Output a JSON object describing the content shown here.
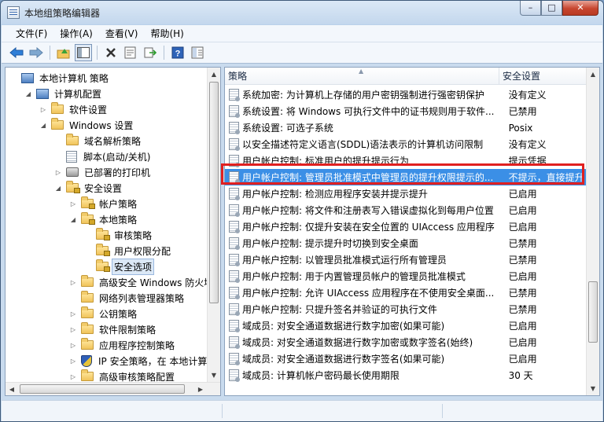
{
  "window": {
    "title": "本地组策略编辑器"
  },
  "window_buttons": {
    "minimize": "–",
    "maximize": "□",
    "close": "✕"
  },
  "menubar": {
    "items": [
      "文件(F)",
      "操作(A)",
      "查看(V)",
      "帮助(H)"
    ]
  },
  "toolbar": {
    "icons": [
      "back-arrow-icon",
      "forward-arrow-icon",
      "up-folder-icon",
      "show-hide-tree-icon",
      "delete-icon",
      "properties-icon",
      "export-list-icon",
      "help-icon",
      "extended-view-icon"
    ]
  },
  "tree": {
    "items": [
      {
        "label": "本地计算机 策略",
        "level": 0,
        "icon": "pc-icon",
        "twisty": ""
      },
      {
        "label": "计算机配置",
        "level": 1,
        "icon": "pc-icon",
        "twisty": "◢"
      },
      {
        "label": "软件设置",
        "level": 2,
        "icon": "folder-icon",
        "twisty": "▷"
      },
      {
        "label": "Windows 设置",
        "level": 2,
        "icon": "folder-icon",
        "twisty": "◢"
      },
      {
        "label": "域名解析策略",
        "level": 3,
        "icon": "folder-icon",
        "twisty": ""
      },
      {
        "label": "脚本(启动/关机)",
        "level": 3,
        "icon": "script-icon",
        "twisty": ""
      },
      {
        "label": "已部署的打印机",
        "level": 3,
        "icon": "printer-icon",
        "twisty": "▷"
      },
      {
        "label": "安全设置",
        "level": 3,
        "icon": "lock-folder-icon",
        "twisty": "◢"
      },
      {
        "label": "帐户策略",
        "level": 4,
        "icon": "lock-folder-icon",
        "twisty": "▷"
      },
      {
        "label": "本地策略",
        "level": 4,
        "icon": "lock-folder-icon",
        "twisty": "◢"
      },
      {
        "label": "审核策略",
        "level": 5,
        "icon": "lock-folder-icon",
        "twisty": ""
      },
      {
        "label": "用户权限分配",
        "level": 5,
        "icon": "lock-folder-icon",
        "twisty": ""
      },
      {
        "label": "安全选项",
        "level": 5,
        "icon": "lock-folder-icon",
        "twisty": "",
        "selected": true
      },
      {
        "label": "高级安全 Windows 防火墙",
        "level": 4,
        "icon": "folder-icon",
        "twisty": "▷"
      },
      {
        "label": "网络列表管理器策略",
        "level": 4,
        "icon": "folder-icon",
        "twisty": ""
      },
      {
        "label": "公钥策略",
        "level": 4,
        "icon": "folder-icon",
        "twisty": "▷"
      },
      {
        "label": "软件限制策略",
        "level": 4,
        "icon": "folder-icon",
        "twisty": "▷"
      },
      {
        "label": "应用程序控制策略",
        "level": 4,
        "icon": "folder-icon",
        "twisty": "▷"
      },
      {
        "label": "IP 安全策略，在 本地计算机",
        "level": 4,
        "icon": "shield-icon",
        "twisty": "▷"
      },
      {
        "label": "高级审核策略配置",
        "level": 4,
        "icon": "folder-icon",
        "twisty": "▷"
      }
    ]
  },
  "list": {
    "headers": {
      "policy": "策略",
      "setting": "安全设置"
    },
    "rows": [
      {
        "policy": "系统加密: 为计算机上存储的用户密钥强制进行强密钥保护",
        "setting": "没有定义"
      },
      {
        "policy": "系统设置: 将 Windows 可执行文件中的证书规则用于软件...",
        "setting": "已禁用"
      },
      {
        "policy": "系统设置: 可选子系统",
        "setting": "Posix"
      },
      {
        "policy": "以安全描述符定义语言(SDDL)语法表示的计算机访问限制",
        "setting": "没有定义"
      },
      {
        "policy": "用户帐户控制: 标准用户的提升提示行为",
        "setting": "提示凭据"
      },
      {
        "policy": "用户帐户控制: 管理员批准模式中管理员的提升权限提示的...",
        "setting": "不提示，直接提升",
        "selected": true
      },
      {
        "policy": "用户帐户控制: 检测应用程序安装并提示提升",
        "setting": "已启用"
      },
      {
        "policy": "用户帐户控制: 将文件和注册表写入错误虚拟化到每用户位置",
        "setting": "已启用"
      },
      {
        "policy": "用户帐户控制: 仅提升安装在安全位置的 UIAccess 应用程序",
        "setting": "已启用"
      },
      {
        "policy": "用户帐户控制: 提示提升时切换到安全桌面",
        "setting": "已禁用"
      },
      {
        "policy": "用户帐户控制: 以管理员批准模式运行所有管理员",
        "setting": "已禁用"
      },
      {
        "policy": "用户帐户控制: 用于内置管理员帐户的管理员批准模式",
        "setting": "已启用"
      },
      {
        "policy": "用户帐户控制: 允许 UIAccess 应用程序在不使用安全桌面...",
        "setting": "已禁用"
      },
      {
        "policy": "用户帐户控制: 只提升签名并验证的可执行文件",
        "setting": "已禁用"
      },
      {
        "policy": "域成员: 对安全通道数据进行数字加密(如果可能)",
        "setting": "已启用"
      },
      {
        "policy": "域成员: 对安全通道数据进行数字加密或数字签名(始终)",
        "setting": "已启用"
      },
      {
        "policy": "域成员: 对安全通道数据进行数字签名(如果可能)",
        "setting": "已启用"
      },
      {
        "policy": "域成员: 计算机帐户密码最长使用期限",
        "setting": "30 天"
      }
    ]
  }
}
